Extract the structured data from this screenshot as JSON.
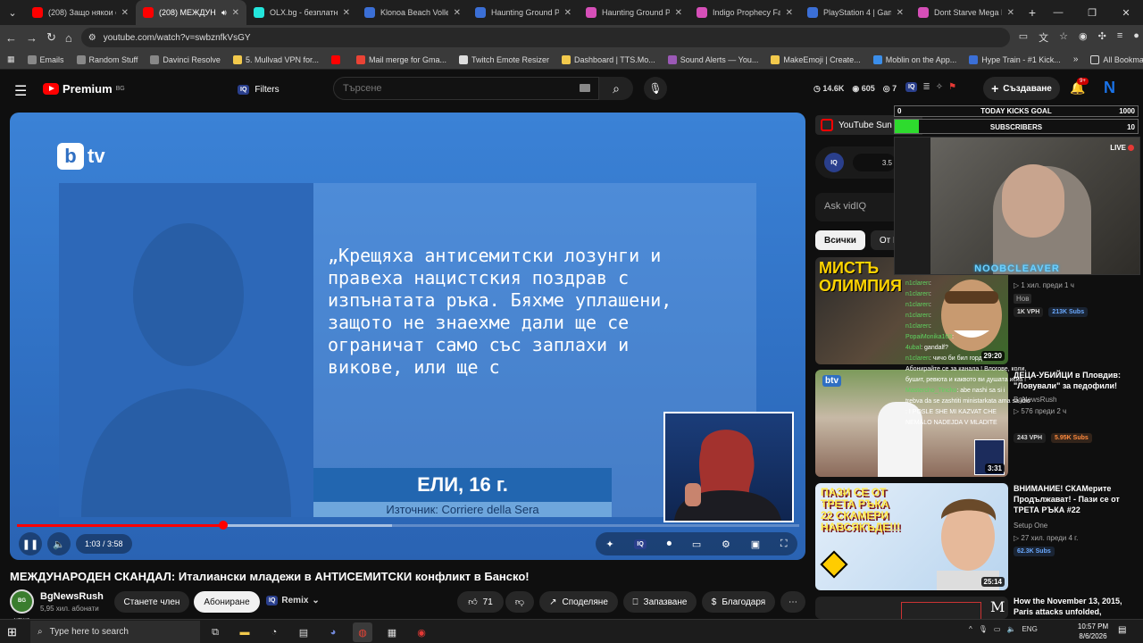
{
  "browser": {
    "tabs": [
      {
        "title": "(208) Защо някои ст...",
        "color": "#ff0000"
      },
      {
        "title": "(208) МЕЖДУНА...",
        "color": "#ff0000",
        "active": true
      },
      {
        "title": "OLX.bg - безплатни...",
        "color": "#23e5db"
      },
      {
        "title": "Klonoa Beach Volley...",
        "color": "#3b6fd6"
      },
      {
        "title": "Haunting Ground Pri...",
        "color": "#3b6fd6"
      },
      {
        "title": "Haunting Ground PS...",
        "color": "#d64fb8"
      },
      {
        "title": "Indigo Prophecy Fah...",
        "color": "#d64fb8"
      },
      {
        "title": "PlayStation 4 | Gamel...",
        "color": "#3b6fd6"
      },
      {
        "title": "Dont Starve Mega Pa...",
        "color": "#d64fb8"
      }
    ],
    "url": "youtube.com/watch?v=swbznfkVsGY",
    "bookmarks": [
      {
        "label": "Emails",
        "color": "#888"
      },
      {
        "label": "Random Stuff",
        "color": "#888"
      },
      {
        "label": "Davinci Resolve",
        "color": "#888"
      },
      {
        "label": "5. Mullvad VPN for...",
        "color": "#f2c94c"
      },
      {
        "label": "",
        "color": "#ff0000"
      },
      {
        "label": "Mail merge for Gma...",
        "color": "#ea4335"
      },
      {
        "label": "Twitch Emote Resizer",
        "color": "#ddd"
      },
      {
        "label": "Dashboard | TTS.Mo...",
        "color": "#f2c94c"
      },
      {
        "label": "Sound Alerts — You...",
        "color": "#9b59b6"
      },
      {
        "label": "MakeEmoji | Create...",
        "color": "#f2c94c"
      },
      {
        "label": "Moblin on the App...",
        "color": "#3b8eea"
      },
      {
        "label": "Hype Train - #1 Kick...",
        "color": "#3b6fd6"
      }
    ],
    "all_bookmarks": "All Bookmarks"
  },
  "yt": {
    "premium": "Premium",
    "region": "BG",
    "filters": "Filters",
    "search_placeholder": "Търсене",
    "stats": {
      "views": "14.6K",
      "likes": "605",
      "watching": "7"
    },
    "create": "Създаване",
    "notif_badge": "9+"
  },
  "video": {
    "quote": "„Крещяха антисемитски лозунги и правеха нацистския поздрав с изпънатата ръка. Бяхме уплашени, защото не знаехме дали ще се ограничат само със заплахи и викове, или ще с",
    "name": "ЕЛИ, 16 г.",
    "source": "Източник: Corriere della Sera",
    "time": "1:03 / 3:58",
    "progress": 0.264,
    "loaded": 0.48,
    "title": "МЕЖДУНАРОДЕН СКАНДАЛ: Италиански младежи в АНТИСЕМИТСКИ конфликт в Банско!"
  },
  "channel": {
    "name": "BgNewsRush",
    "subs": "5,95 хил. абонати",
    "avatar_text": "BG NEWS",
    "member": "Станете член",
    "subscribe": "Абониране",
    "remix": "Remix"
  },
  "actions": {
    "likes": "71",
    "share": "Споделяне",
    "save": "Запазване",
    "thanks": "Благодаря"
  },
  "sidebar": {
    "summary": "YouTube Sun",
    "vidiq_value": "3.5",
    "ask": "Ask vidIQ",
    "chips": [
      "Всички",
      "От Bg"
    ],
    "recs": [
      {
        "title": "",
        "channel": "",
        "meta": "1 хил.  преди 1 ч",
        "tag": "Нов",
        "vph": "1K VPH",
        "subs": "213K Subs",
        "dur": "29:20",
        "thumb_text": "МИСТЪ ОЛИМПИЯ",
        "subs_color": "b"
      },
      {
        "title": "ДЕЦА-УБИЙЦИ в Пловдив: \"Ловували\" за педофили!",
        "channel": "BgNewsRush",
        "meta": "576  преди 2 ч",
        "tag": "",
        "vph": "243 VPH",
        "subs": "5.95K Subs",
        "dur": "3:31",
        "thumb_text": "btv",
        "subs_color": "g"
      },
      {
        "title": "ВНИМАНИЕ! СКАМерите Продължават! - Пази се от ТРЕТА РЪКА #22",
        "channel": "Setup One",
        "meta": "27 хил.  преди 4 г.",
        "tag": "",
        "vph": "",
        "subs": "62.3K Subs",
        "dur": "25:14",
        "thumb_text": "ПАЗИ СЕ ОТ ТРЕТА РЪКА 22 СКАМЕРИ НАВСЯКЪДЕ!!!",
        "subs_color": "b"
      },
      {
        "title": "How the November 13, 2015, Paris attacks unfolded,",
        "channel": "",
        "meta": "",
        "tag": "",
        "vph": "",
        "subs": "",
        "dur": "",
        "thumb_text": "",
        "subs_color": "g"
      }
    ]
  },
  "overlay": {
    "goal_left": "0",
    "goal_label": "TODAY KICKS GOAL",
    "goal_right": "1000",
    "subs_label": "SUBSCRIBERS",
    "subs_right": "10",
    "subs_fill": 0.1,
    "live": "LIVE",
    "streamer": "NOOBCLEAVER",
    "chat": [
      {
        "u": "n1claren",
        "m": ":"
      },
      {
        "u": "n1claren",
        "m": ":"
      },
      {
        "u": "n1claren",
        "m": ":"
      },
      {
        "u": "n1claren",
        "m": ":"
      },
      {
        "u": "n1claren",
        "m": ":"
      },
      {
        "u": "PopaiMonika168",
        "m": ":"
      },
      {
        "u": "4ubal",
        "m": ": gandalf?"
      },
      {
        "u": "n1claren",
        "m": ": чичо би бил горд"
      },
      {
        "u": "",
        "m": ""
      },
      {
        "u": "",
        "m": "Абонирайте се за канала ! Влогове, коли,"
      },
      {
        "u": "",
        "m": "бушит, ревюта и каквото ви душата иска !"
      },
      {
        "u": "Mastercho_Tincho",
        "m": ": abe nashi sa si i"
      },
      {
        "u": "",
        "m": "trebva da se zashtiti ministarkata ama sa idioti br"
      },
      {
        "u": "",
        "m": ": I POSLE SHE MI KAZVAT CHE"
      },
      {
        "u": "",
        "m": "NEMALO NADEJDA V MLADITE"
      }
    ]
  },
  "taskbar": {
    "search": "Type here to search",
    "lang": "ENG",
    "time": "10:57 PM",
    "date": "8/6/2026"
  }
}
